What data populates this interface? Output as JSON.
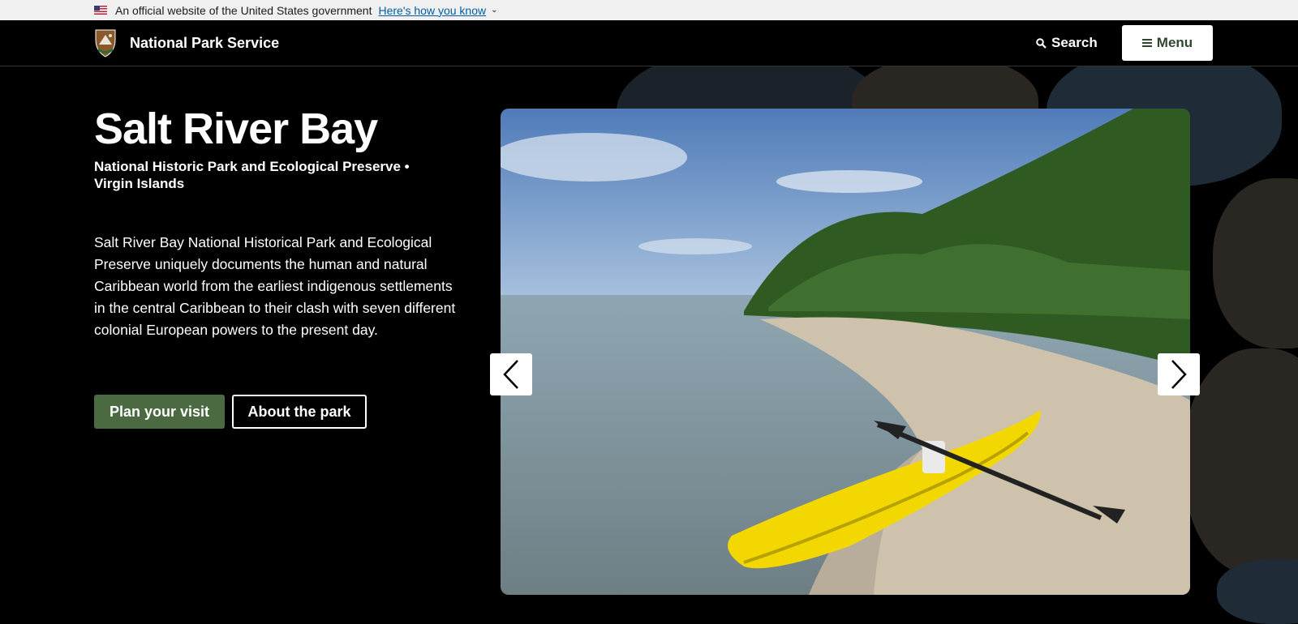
{
  "gov_banner": {
    "text": "An official website of the United States government",
    "link": "Here's how you know"
  },
  "header": {
    "site_name": "National Park Service",
    "search_label": "Search",
    "menu_label": "Menu"
  },
  "hero": {
    "title": "Salt River Bay",
    "subtitle": "National Historic Park and Ecological Preserve • Virgin Islands",
    "description": "Salt River Bay National Historical Park and Ecological Preserve uniquely documents the human and natural Caribbean world from the earliest indigenous settlements in the central Caribbean to their clash with seven different colonial European powers to the present day.",
    "primary_button": "Plan your visit",
    "secondary_button": "About the park"
  },
  "icons": {
    "flag": "us-flag-icon",
    "logo": "nps-arrowhead-icon",
    "search": "search-icon",
    "menu": "hamburger-icon",
    "prev": "chevron-left-icon",
    "next": "chevron-right-icon"
  },
  "colors": {
    "primary_button": "#4b6a41",
    "menu_text": "#2f4731",
    "banner_link": "#005ea2"
  }
}
